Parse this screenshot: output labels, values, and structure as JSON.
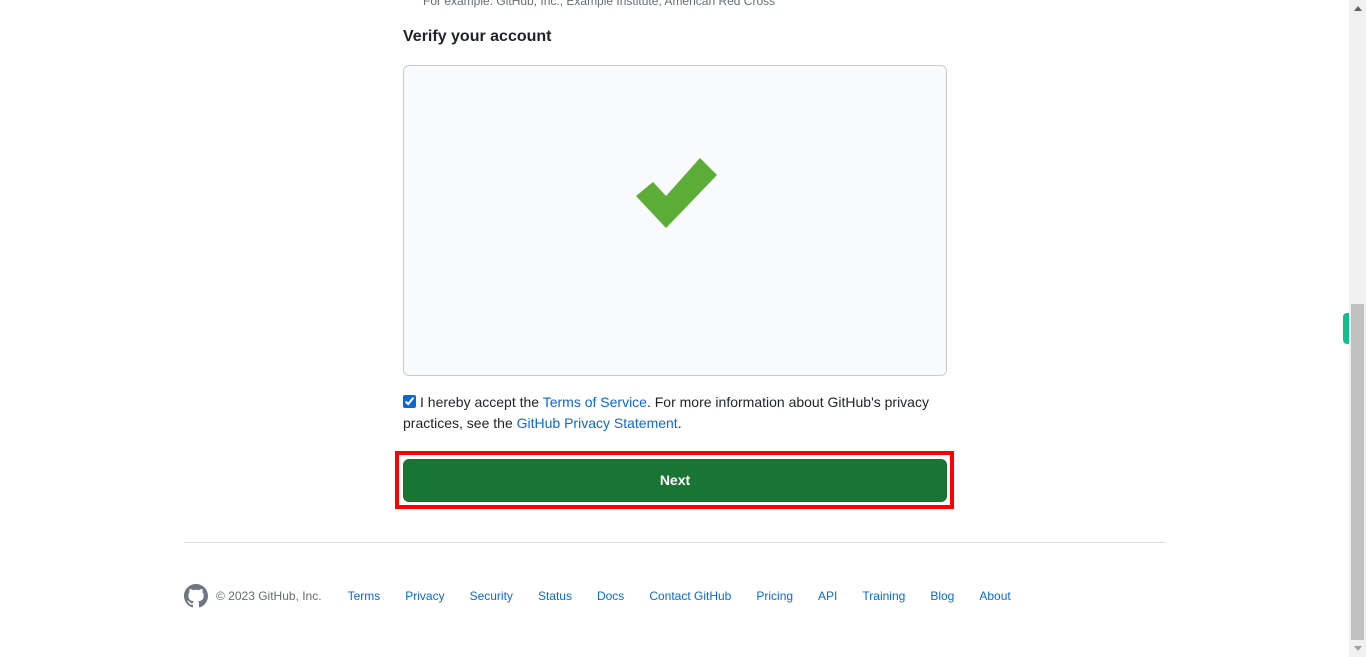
{
  "form": {
    "org_hint": "For example: GitHub, Inc., Example Institute, American Red Cross",
    "verify_title": "Verify your account",
    "captcha": {
      "status": "verified",
      "icon": "checkmark-icon",
      "icon_color": "#5bad37"
    },
    "terms": {
      "checked": true,
      "prefix": "I hereby accept the ",
      "tos_link": "Terms of Service",
      "middle": ". For more information about GitHub's privacy practices, see the ",
      "privacy_link": "GitHub Privacy Statement",
      "suffix": "."
    },
    "next_button": {
      "label": "Next",
      "color": "#1a7535",
      "highlight_color": "#ff0000"
    }
  },
  "footer": {
    "logo": "github-mark-icon",
    "copyright": "© 2023 GitHub, Inc.",
    "links": [
      "Terms",
      "Privacy",
      "Security",
      "Status",
      "Docs",
      "Contact GitHub",
      "Pricing",
      "API",
      "Training",
      "Blog",
      "About"
    ]
  }
}
